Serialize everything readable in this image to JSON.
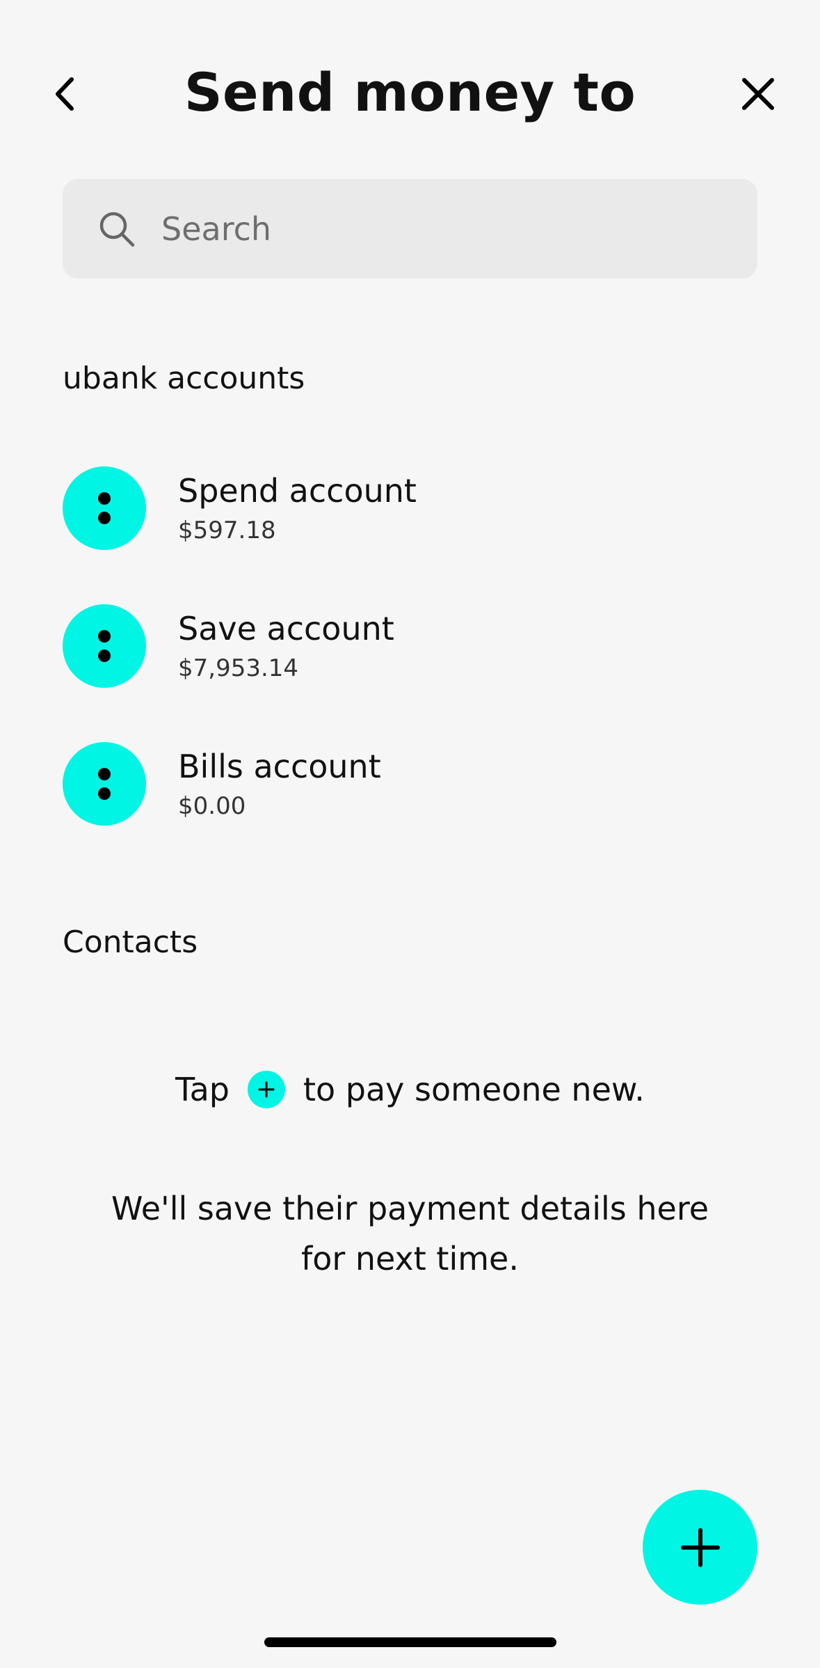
{
  "header": {
    "title": "Send money to"
  },
  "search": {
    "placeholder": "Search",
    "value": ""
  },
  "sections": {
    "accounts_heading": "ubank accounts",
    "contacts_heading": "Contacts"
  },
  "accounts": [
    {
      "name": "Spend account",
      "balance": "$597.18"
    },
    {
      "name": "Save account",
      "balance": "$7,953.14"
    },
    {
      "name": "Bills account",
      "balance": "$0.00"
    }
  ],
  "empty_contacts": {
    "tap_before": "Tap",
    "tap_after": "to pay someone new.",
    "save_message": "We'll save their payment details here for next time."
  },
  "colors": {
    "accent": "#00f5e4",
    "background": "#f6f6f6",
    "search_bg": "#eaeaea"
  },
  "icons": {
    "back": "chevron-left-icon",
    "close": "close-icon",
    "search": "search-icon",
    "account": "more-vertical-icon",
    "add": "plus-icon"
  }
}
